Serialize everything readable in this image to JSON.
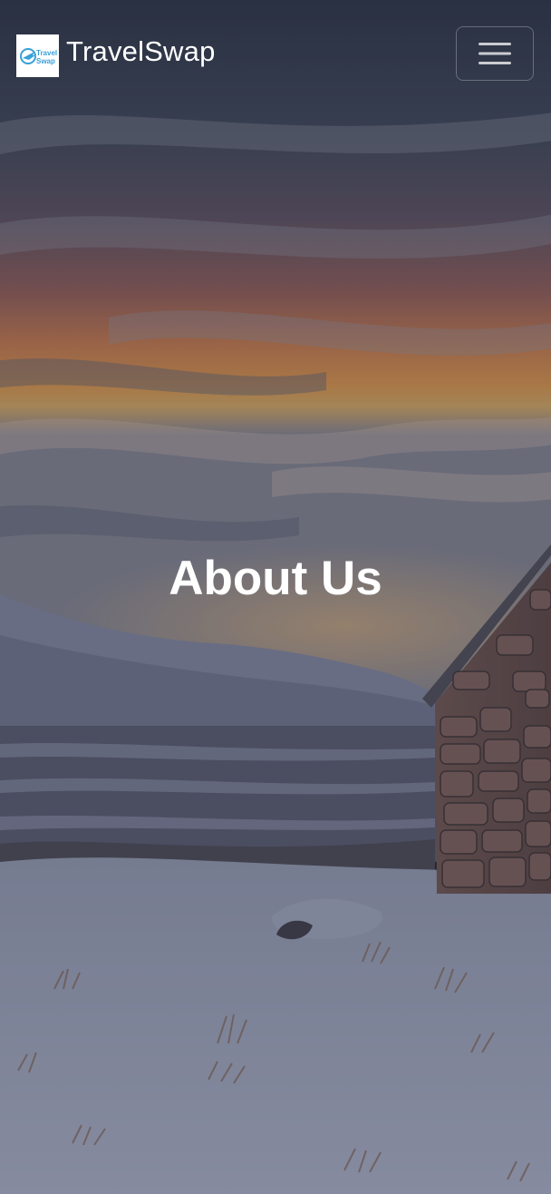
{
  "navbar": {
    "brand_name": "TravelSwap",
    "logo_text_line1": "Travel",
    "logo_text_line2": "Swap",
    "menu_icon": "hamburger-menu-icon"
  },
  "hero": {
    "title": "About Us",
    "background": "snowy-highland-sunset-with-stone-bothy"
  },
  "colors": {
    "title_text": "#ffffff",
    "logo_accent": "#3aa0d8",
    "overlay": "#1f2433"
  }
}
